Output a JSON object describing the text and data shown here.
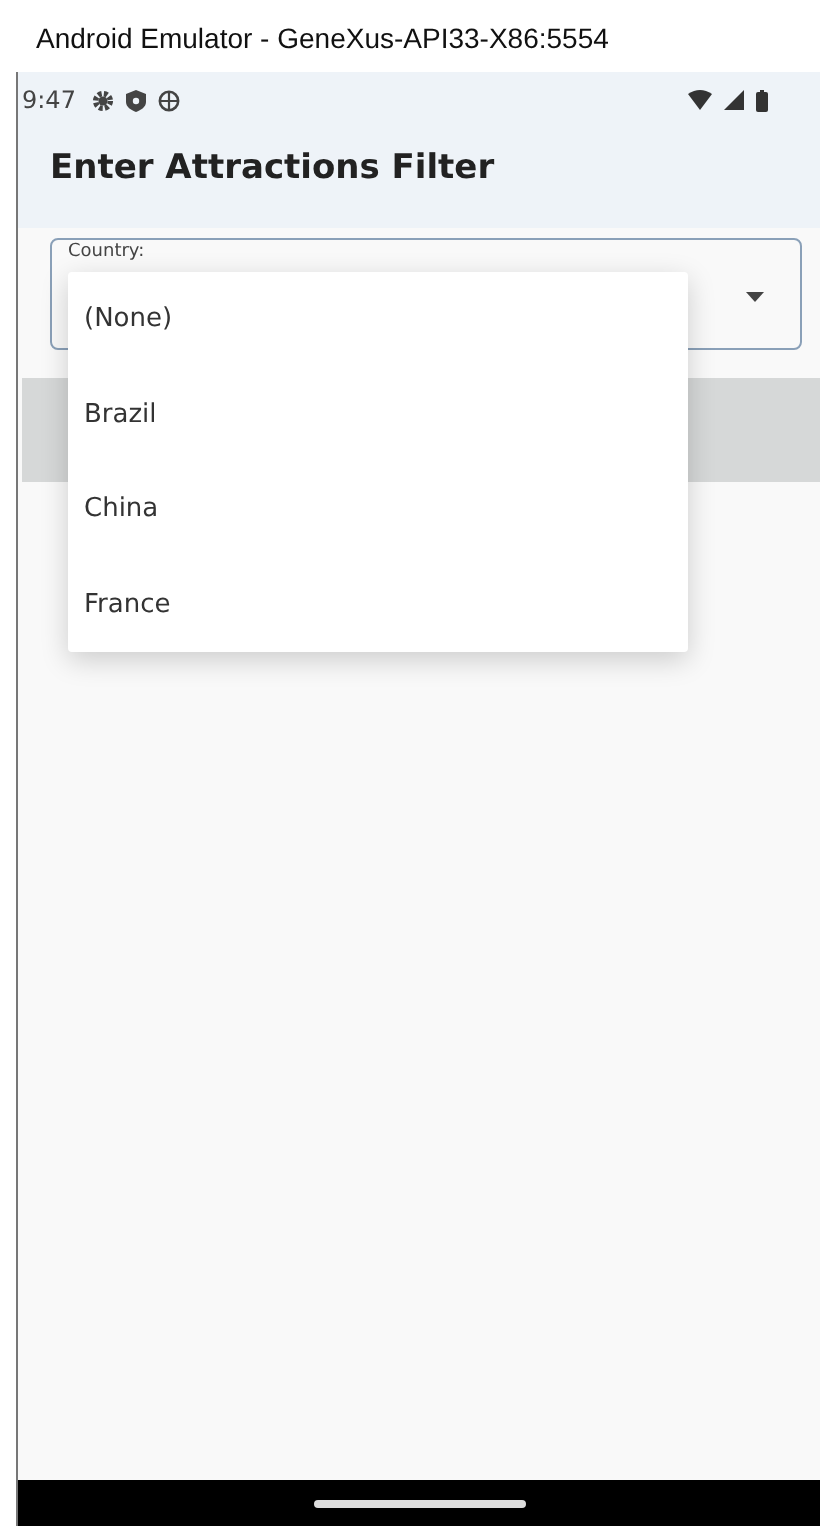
{
  "window": {
    "title": "Android Emulator - GeneXus-API33-X86:5554"
  },
  "status_bar": {
    "time": "9:47"
  },
  "app_bar": {
    "title": "Enter Attractions Filter"
  },
  "country_field": {
    "label": "Country:"
  },
  "dropdown": {
    "options": [
      {
        "label": "(None)"
      },
      {
        "label": "Brazil"
      },
      {
        "label": "China"
      },
      {
        "label": "France"
      }
    ]
  }
}
